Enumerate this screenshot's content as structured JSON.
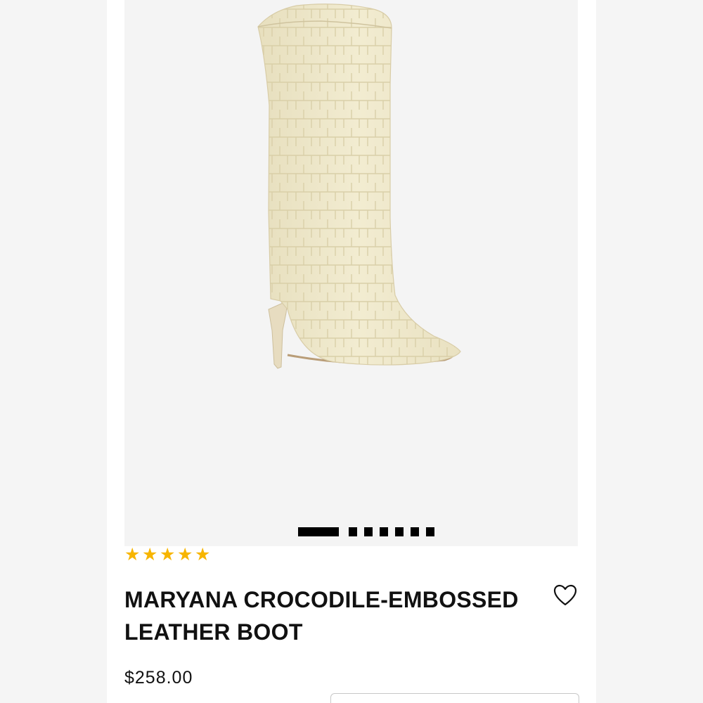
{
  "product": {
    "title": "MARYANA CROCODILE-EMBOSSED LEATHER BOOT",
    "price": "$258.00",
    "rating": 5,
    "rating_max": 5,
    "image_icon": "boot-image",
    "wishlist_icon": "heart-outline-icon",
    "star_icon": "star-icon",
    "star_color": "#f7b500"
  },
  "gallery": {
    "total_images": 7,
    "active_index": 0
  }
}
